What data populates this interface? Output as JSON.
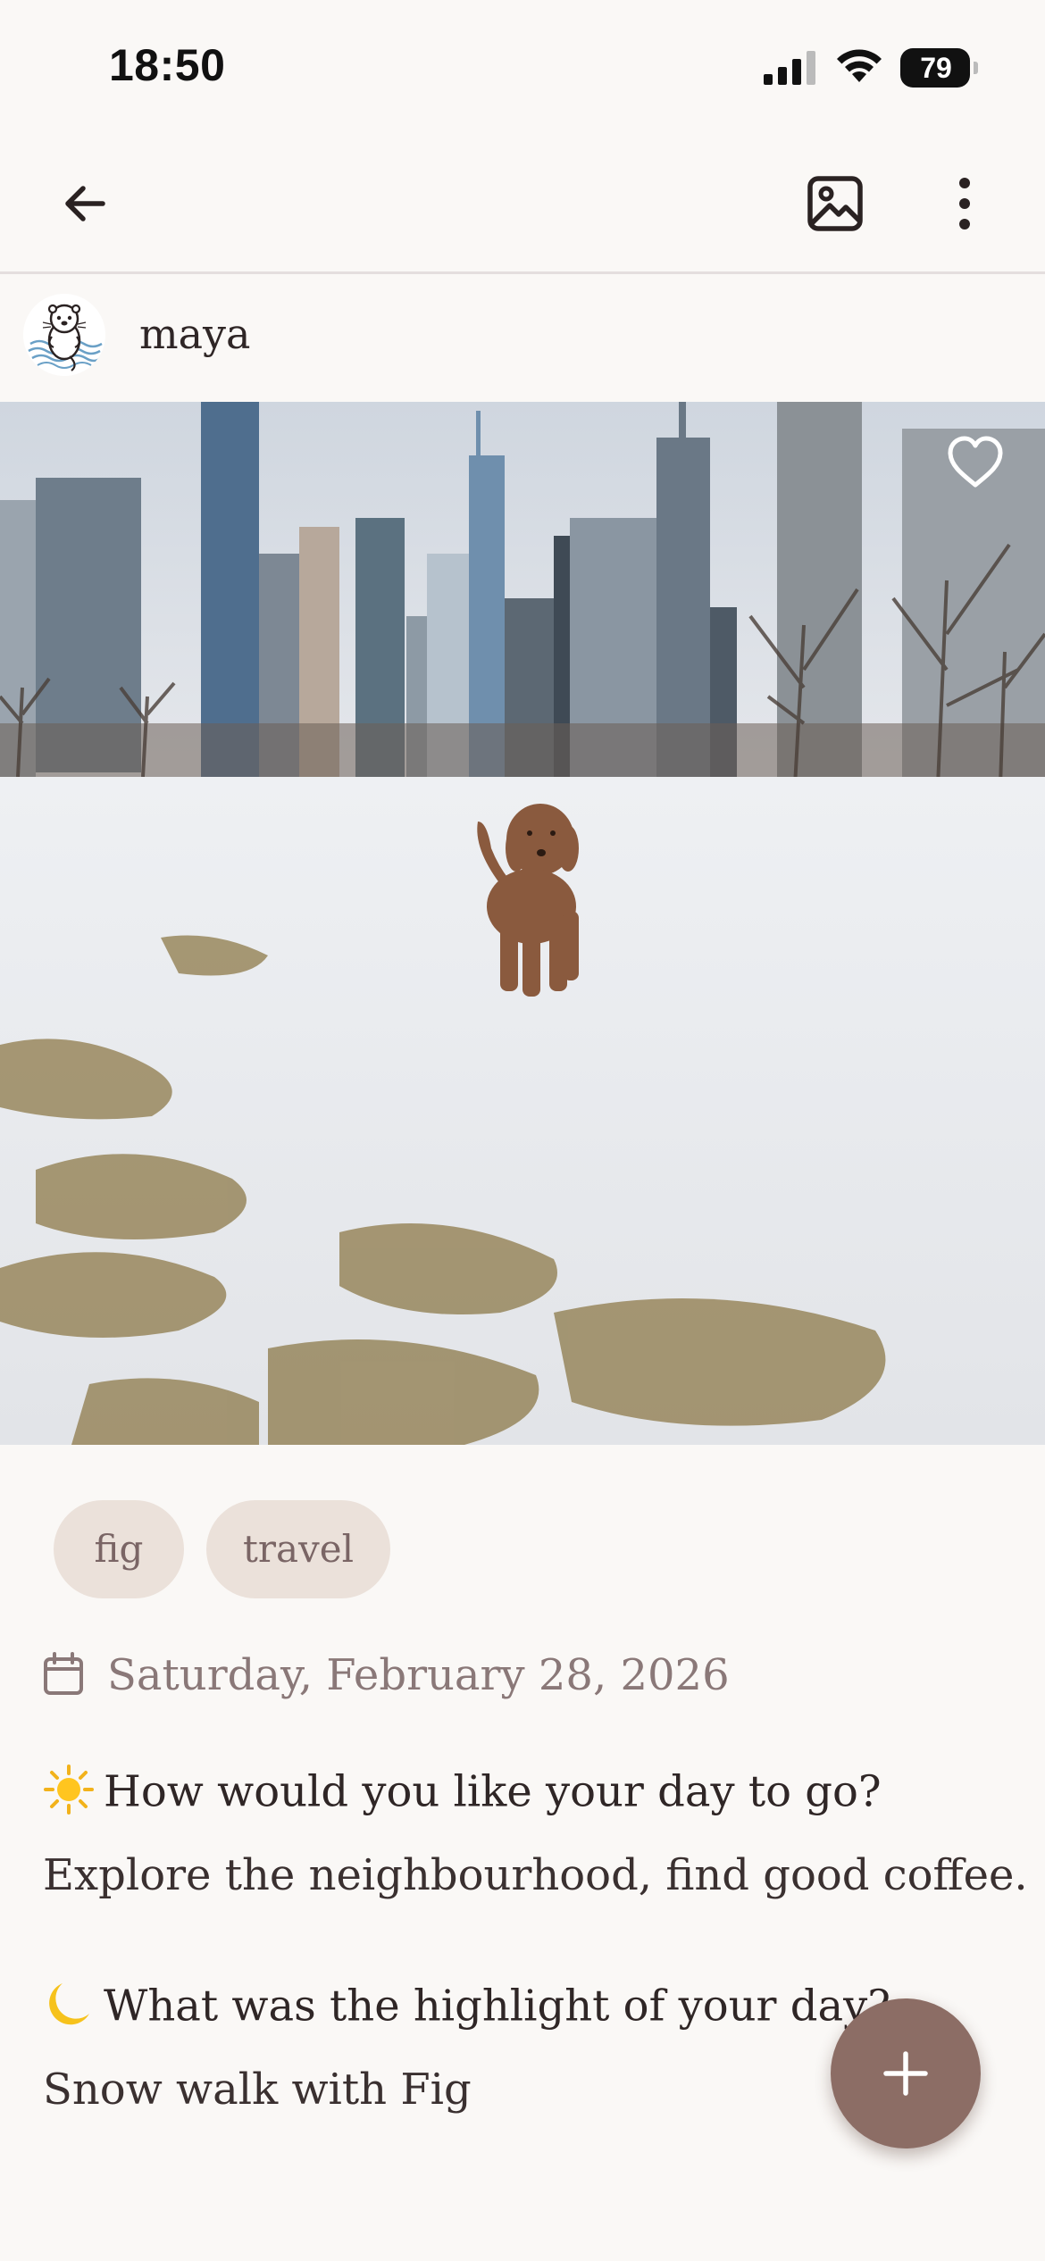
{
  "status_bar": {
    "time": "18:50",
    "battery_level": "79",
    "icons": [
      "signal-icon",
      "wifi-icon",
      "battery-icon"
    ]
  },
  "app_bar": {
    "icons": [
      "back-arrow-icon",
      "image-icon",
      "more-vertical-icon"
    ]
  },
  "author": {
    "name": "maya",
    "avatar_icon": "otter-avatar-icon"
  },
  "photo": {
    "favorite_icon": "heart-outline-icon"
  },
  "tags": [
    "fig",
    "travel"
  ],
  "entry": {
    "date_icon": "calendar-icon",
    "date": "Saturday, February 28, 2026",
    "prompts": [
      {
        "emoji": "☀️",
        "question": "How would you like your day to go?",
        "answer": "Explore the neighbourhood, find good coffee."
      },
      {
        "emoji": "🌙",
        "question": "What was the highlight of your day?",
        "answer": "Snow walk with Fig"
      }
    ]
  },
  "fab": {
    "icon": "plus-icon"
  },
  "colors": {
    "background": "#faf8f6",
    "tag_background": "#ebe1da",
    "tag_text": "#7a6565",
    "accent": "#8c6d65",
    "muted_text": "#8a7878"
  }
}
